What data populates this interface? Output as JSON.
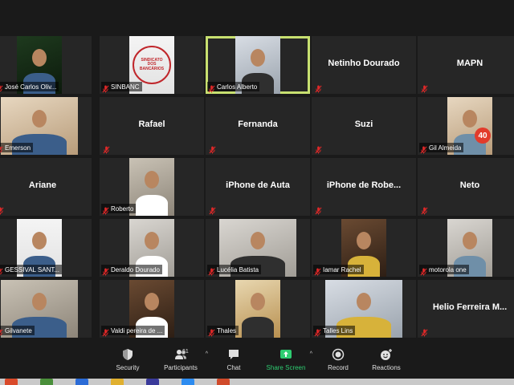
{
  "participants": [
    {
      "name": "José Carlos Oliv...",
      "video": true,
      "bg": "bg-dark"
    },
    {
      "name": "SINBANC",
      "video": true,
      "bg": "bg-white",
      "logo_text": "SINDICATO DOS BANCÁRIOS"
    },
    {
      "name": "Carlos Alberto",
      "video": true,
      "bg": "bg-cool",
      "active": true
    },
    {
      "name": "Netinho Dourado",
      "video": false
    },
    {
      "name": "MAPN",
      "video": false
    },
    {
      "name": "Emerson",
      "video": true,
      "bg": "bg-warm",
      "wide": true
    },
    {
      "name": "Rafael",
      "video": false
    },
    {
      "name": "Fernanda",
      "video": false
    },
    {
      "name": "Suzi",
      "video": false
    },
    {
      "name": "Gil Almeida",
      "video": true,
      "bg": "bg-warm",
      "badge": "40"
    },
    {
      "name": "Ariane",
      "video": false
    },
    {
      "name": "Roberto",
      "video": true,
      "bg": "bg-room"
    },
    {
      "name": "iPhone de Auta",
      "video": false
    },
    {
      "name": "iPhone  de  Robe...",
      "video": false
    },
    {
      "name": "Neto",
      "video": false
    },
    {
      "name": "GESSIVAL SANT...",
      "video": true,
      "bg": "bg-white"
    },
    {
      "name": "Deraldo Dourado",
      "video": true,
      "bg": "bg-gray"
    },
    {
      "name": "Lucélia Batista",
      "video": true,
      "bg": "bg-gray",
      "wide": true
    },
    {
      "name": "Iamar Rachel",
      "video": true,
      "bg": "bg-brown"
    },
    {
      "name": "motorola one",
      "video": true,
      "bg": "bg-gray"
    },
    {
      "name": "Gilvanete",
      "video": true,
      "bg": "bg-room",
      "wide": true
    },
    {
      "name": "Valdi pereira de ...",
      "video": true,
      "bg": "bg-brown"
    },
    {
      "name": "Thales",
      "video": true,
      "bg": "bg-yellow"
    },
    {
      "name": "Talles Lins",
      "video": true,
      "bg": "bg-cool",
      "wide": true
    },
    {
      "name": "Helio  Ferreira  M...",
      "video": false
    }
  ],
  "toolbar": {
    "security_label": "Security",
    "participants_label": "Participants",
    "participants_count": "61",
    "chat_label": "Chat",
    "share_label": "Share Screen",
    "record_label": "Record",
    "reactions_label": "Reactions"
  },
  "colors": {
    "active_border": "#c8e070",
    "tile_bg": "#262626",
    "muted_red": "#e02828",
    "share_green": "#2ecc71"
  }
}
